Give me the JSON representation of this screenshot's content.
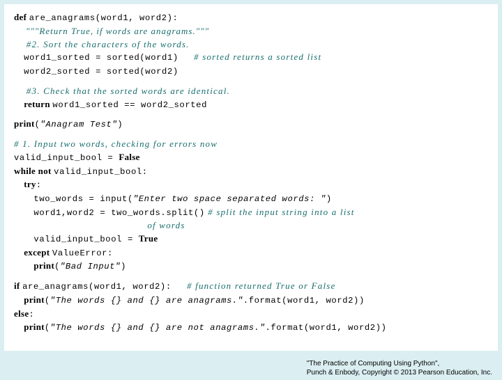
{
  "code": {
    "l1a": "def ",
    "l1b": "are_anagrams(word1, word2):",
    "l2": "    \"\"\"Return True, if words are anagrams.\"\"\"",
    "l3": "    #2. Sort the characters of the words.",
    "l4a": "    ",
    "l4b": "word1_sorted = sorted(word1)",
    "l4c": "     # sorted returns a sorted list",
    "l5a": "    ",
    "l5b": "word2_sorted = sorted(word2)",
    "l6": "    #3. Check that the sorted words are identical.",
    "l7a": "    return ",
    "l7b": "word1_sorted == word2_sorted",
    "l8a": "print",
    "l8b": "(",
    "l8c": "\"Anagram Test\"",
    "l8d": ")",
    "l9": "# 1. Input two words, checking for errors now",
    "l10a": "valid_input_bool = ",
    "l10b": "False",
    "l11a": "while not ",
    "l11b": "valid_input_bool:",
    "l12a": "    try",
    "l12b": ":",
    "l13a": "        ",
    "l13b": "two_words = input(",
    "l13c": "\"Enter two space separated words: \"",
    "l13d": ")",
    "l14a": "        ",
    "l14b": "word1,word2 = two_words.split()",
    "l14c": " # split the input string into a list",
    "l14d": "                                           of words",
    "l15a": "        ",
    "l15b": "valid_input_bool = ",
    "l15c": "True",
    "l16a": "    except ",
    "l16b": "ValueError:",
    "l17a": "        print",
    "l17b": "(",
    "l17c": "\"Bad Input\"",
    "l17d": ")",
    "l18a": "if ",
    "l18b": "are_anagrams(word1, word2):",
    "l18c": "     # function returned True or False",
    "l19a": "    print",
    "l19b": "(",
    "l19c": "\"The words {} and {} are anagrams.\"",
    "l19d": ".format(word1, word2))",
    "l20a": "else",
    "l20b": ":",
    "l21a": "    print",
    "l21b": "(",
    "l21c": "\"The words {} and {} are not anagrams.\"",
    "l21d": ".format(word1, word2))"
  },
  "footer": {
    "line1": "\"The Practice of Computing Using Python\",",
    "line2": "Punch & Enbody, Copyright © 2013 Pearson Education, Inc."
  }
}
